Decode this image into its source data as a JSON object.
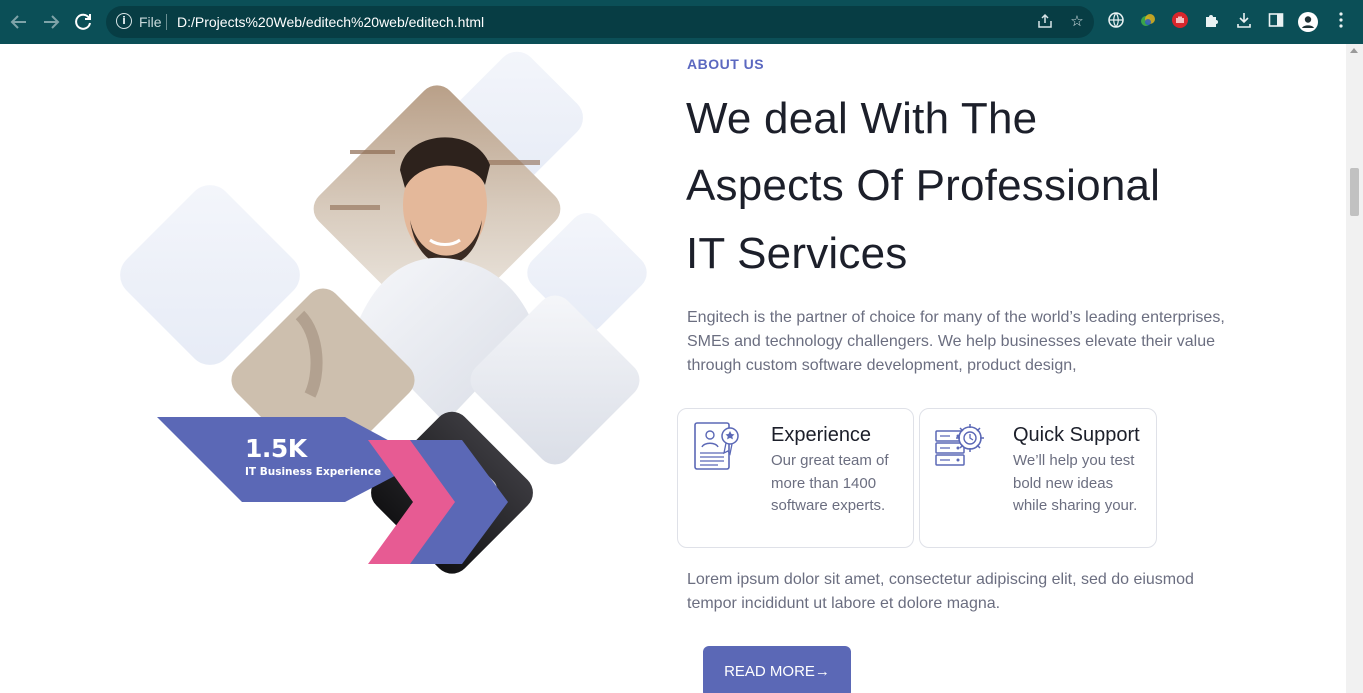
{
  "browser": {
    "back_icon": "arrow-left",
    "forward_icon": "arrow-right",
    "reload_icon": "reload",
    "info_icon": "info",
    "scheme_label": "File",
    "url": "D:/Projects%20Web/editech%20web/editech.html",
    "toolbar_icons": [
      "share",
      "star",
      "globe-extension",
      "color-extension",
      "adblock-extension",
      "puzzle-extensions",
      "download",
      "side-panel",
      "profile",
      "menu-dots"
    ],
    "colors": {
      "frame": "#0b4f57",
      "omnibox": "#073d44"
    }
  },
  "hero": {
    "badge": {
      "value": "1.5K",
      "label": "IT Business Experience"
    },
    "colors": {
      "badge": "#5b68b6",
      "chevron_pink": "#e75b93",
      "diamond_light": "#eef2fa"
    }
  },
  "about": {
    "eyebrow": "ABOUT US",
    "heading_lines": [
      "We deal With The",
      "Aspects Of Professional",
      "IT Services"
    ],
    "intro": "Engitech is the partner of choice for many of the world’s leading enterprises, SMEs and technology challengers. We help businesses elevate their value through custom software development, product design,",
    "cards": [
      {
        "icon": "certificate-icon",
        "title": "Experience",
        "text": "Our great team of more than 1400 software experts."
      },
      {
        "icon": "server-gear-icon",
        "title": "Quick Support",
        "text": "We’ll help you test bold new ideas while sharing your."
      }
    ],
    "outro": "Lorem ipsum dolor sit amet, consectetur adipiscing elit, sed do eiusmod tempor incididunt ut labore et dolore magna.",
    "button_label": "READ MORE→",
    "colors": {
      "accent": "#5b68c0",
      "heading": "#1c1f2a",
      "body": "#6b6e80"
    }
  }
}
